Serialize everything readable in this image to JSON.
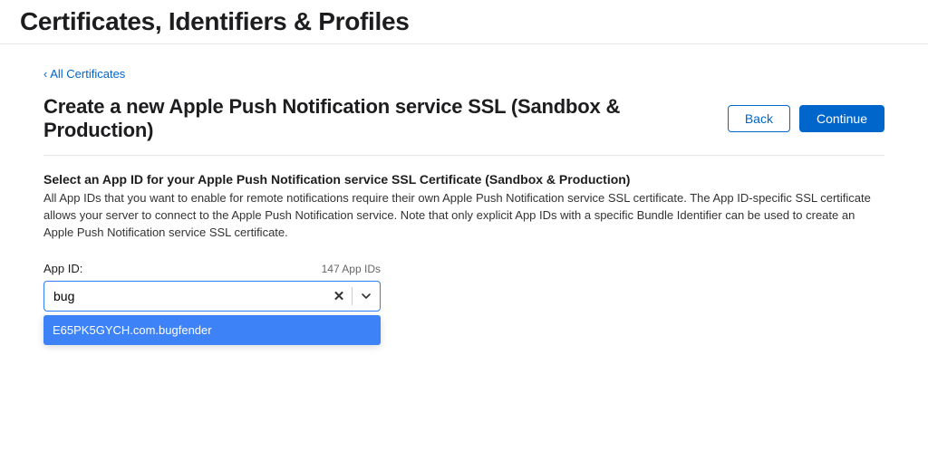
{
  "header": {
    "title": "Certificates, Identifiers & Profiles"
  },
  "breadcrumb": {
    "back_link": "‹ All Certificates"
  },
  "page": {
    "title": "Create a new Apple Push Notification service SSL (Sandbox & Production)"
  },
  "buttons": {
    "back": "Back",
    "continue": "Continue"
  },
  "section": {
    "heading": "Select an App ID for your Apple Push Notification service SSL Certificate (Sandbox & Production)",
    "desc": "All App IDs that you want to enable for remote notifications require their own Apple Push Notification service SSL certificate. The App ID-specific SSL certificate allows your server to connect to the Apple Push Notification service. Note that only explicit App IDs with a specific Bundle Identifier can be used to create an Apple Push Notification service SSL certificate."
  },
  "app_id": {
    "label": "App ID:",
    "count": "147 App IDs",
    "value": "bug",
    "options": [
      "E65PK5GYCH.com.bugfender"
    ]
  }
}
